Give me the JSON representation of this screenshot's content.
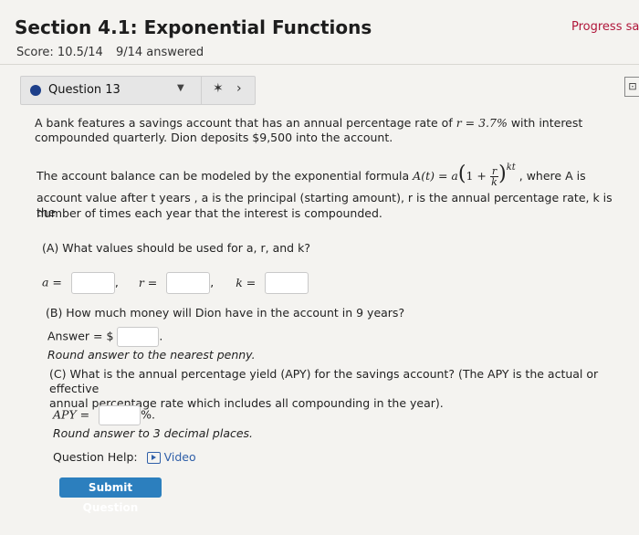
{
  "header": {
    "title": "Section 4.1: Exponential Functions",
    "progress": "Progress sav",
    "score": "Score: 10.5/14",
    "answered": "9/14 answered"
  },
  "question_nav": {
    "label": "Question 13",
    "next": "›",
    "right_button": "⊡"
  },
  "problem": {
    "intro_line1": "A bank features a savings account that has an annual percentage rate of ",
    "rate_expr": "r = 3.7%",
    "intro_line1_end": " with interest",
    "intro_line2": "compounded quarterly. Dion deposits $9,500 into the account.",
    "model_text": "The account balance can be modeled by the exponential formula ",
    "model_formula_left": "A(t) = a",
    "model_formula_exp": "kt",
    "model_text_end": ", where A is",
    "model_line2": "account value after t years , a is the principal (starting amount), r is the annual percentage rate, k is the",
    "model_line3": "number of times each year that the interest is compounded."
  },
  "part_a": {
    "prompt": "(A) What values should be used for a, r, and k?",
    "a_label": "a =",
    "r_label": "r =",
    "k_label": "k ="
  },
  "part_b": {
    "prompt": "(B) How much money will Dion have in the account in 9 years?",
    "answer_label": "Answer = $",
    "round_note": "Round answer to the nearest penny."
  },
  "part_c": {
    "prompt_line1": "(C) What is the annual percentage yield (APY) for the savings account? (The APY is the actual or effective",
    "prompt_line2": "annual percentage rate which includes all compounding in the year).",
    "apy_label": "APY =",
    "percent_suffix": "%.",
    "round_note": "Round answer to 3 decimal places."
  },
  "help": {
    "label": "Question Help:",
    "video": "Video"
  },
  "submit_label": "Submit Question"
}
